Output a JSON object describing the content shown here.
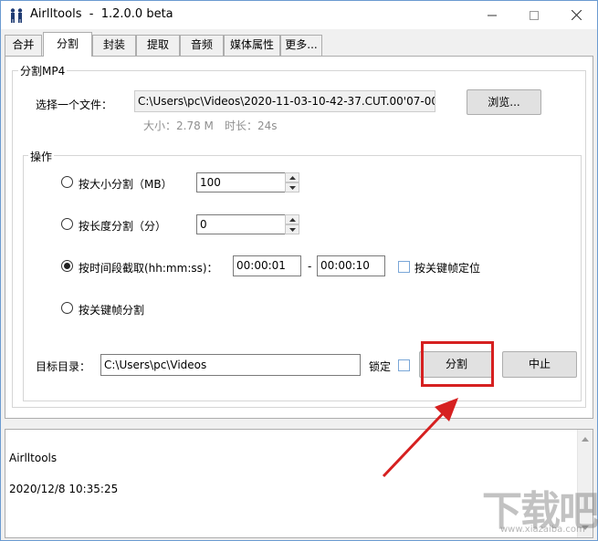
{
  "window": {
    "app_name": "Airlltools",
    "version": "1.2.0.0 beta"
  },
  "tabs": [
    {
      "label": "合并",
      "active": false
    },
    {
      "label": "分割",
      "active": true
    },
    {
      "label": "封装",
      "active": false
    },
    {
      "label": "提取",
      "active": false
    },
    {
      "label": "音频",
      "active": false
    },
    {
      "label": "媒体属性",
      "active": false
    },
    {
      "label": "更多...",
      "active": false
    }
  ],
  "split_mp4": {
    "group_title": "分割MP4",
    "file_label": "选择一个文件：",
    "file_path": "C:\\Users\\pc\\Videos\\2020-11-03-10-42-37.CUT.00'07-00'",
    "browse_label": "浏览...",
    "size_text": "大小：2.78 M",
    "duration_text": "时长：24s"
  },
  "operations": {
    "group_title": "操作",
    "by_size": {
      "label": "按大小分割（MB）",
      "value": "100",
      "checked": false
    },
    "by_length": {
      "label": "按长度分割（分）",
      "value": "0",
      "checked": false
    },
    "by_time": {
      "label": "按时间段截取(hh:mm:ss)：",
      "start": "00:00:01",
      "separator": "-",
      "end": "00:00:10",
      "checked": true,
      "keyframe_label": "按关键帧定位",
      "keyframe_checked": false
    },
    "by_keyframe": {
      "label": "按关键帧分割",
      "checked": false
    },
    "target_label": "目标目录：",
    "target_path": "C:\\Users\\pc\\Videos",
    "lock_label": "锁定",
    "lock_checked": false,
    "split_button": "分割",
    "stop_button": "中止"
  },
  "log": {
    "line1": "Airlltools",
    "line2": "2020/12/8 10:35:25"
  },
  "watermark": {
    "text": "下载吧",
    "sub": "www.xiazaiba.com"
  },
  "colors": {
    "highlight": "#d62020",
    "accent": "#6b9bd1"
  }
}
